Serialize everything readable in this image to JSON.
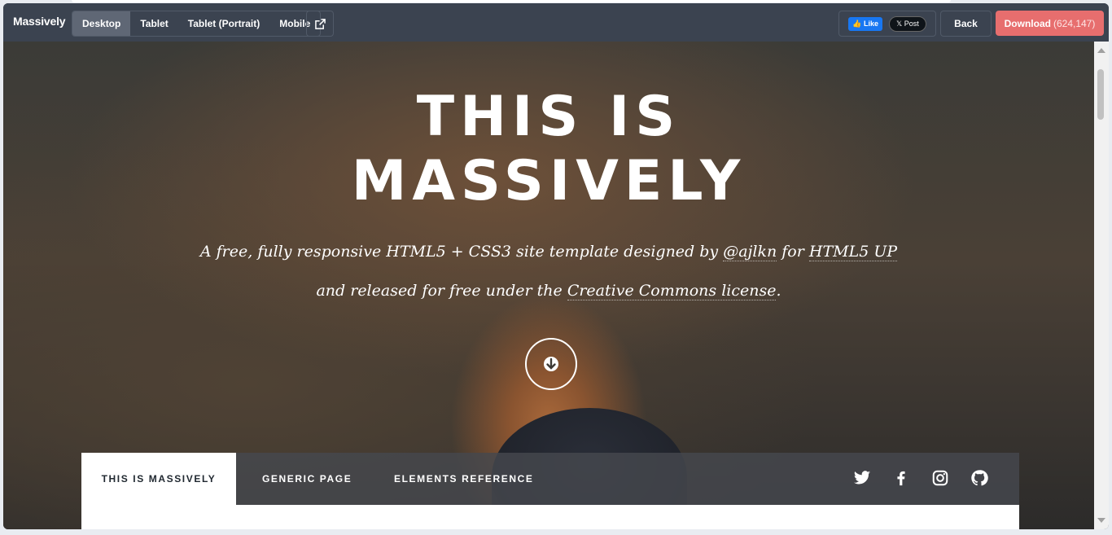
{
  "topbar": {
    "brand": "Massively",
    "devices": [
      "Desktop",
      "Tablet",
      "Tablet (Portrait)",
      "Mobile"
    ],
    "active_device": "Desktop",
    "like_label": "Like",
    "post_label": "Post",
    "back_label": "Back",
    "download_label": "Download",
    "download_count": "(624,147)"
  },
  "hero": {
    "title_line1": "THIS IS",
    "title_line2": "MASSIVELY",
    "intro_1a": "A free, fully responsive HTML5 + CSS3 site template designed by ",
    "intro_link1": "@ajlkn",
    "intro_1b": " for ",
    "intro_link2": "HTML5 UP",
    "intro_2a": "and released for free under the ",
    "intro_link3": "Creative Commons license",
    "intro_2b": "."
  },
  "nav": {
    "items": [
      "THIS IS MASSIVELY",
      "GENERIC PAGE",
      "ELEMENTS REFERENCE"
    ],
    "icons": [
      "twitter-icon",
      "facebook-icon",
      "instagram-icon",
      "github-icon"
    ]
  },
  "colors": {
    "topbar": "#3b4350",
    "download": "#e76e6e",
    "nav_active_bg": "#ffffff"
  }
}
